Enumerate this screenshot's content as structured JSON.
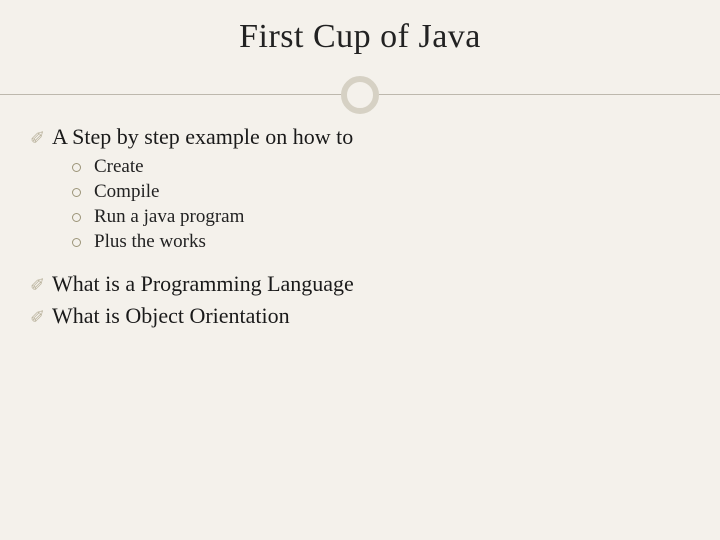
{
  "title": "First Cup of Java",
  "bullets": [
    {
      "text": "A Step by step example on how to",
      "sub": [
        "Create",
        "Compile",
        "Run a java program",
        "Plus the works"
      ]
    },
    {
      "text": "What is a Programming Language",
      "sub": []
    },
    {
      "text": "What is Object Orientation",
      "sub": []
    }
  ],
  "icons": {
    "swirl": "✐"
  }
}
